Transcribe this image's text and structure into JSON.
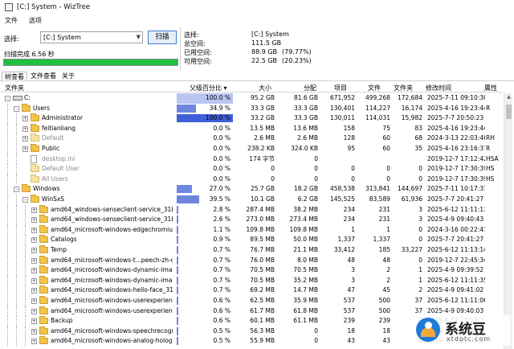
{
  "window": {
    "title": "[C:] System - WizTree"
  },
  "menu": [
    "文件",
    "选项"
  ],
  "scan": {
    "select_label": "选择:",
    "drive": "[C:] System",
    "scan_button": "扫描",
    "status": "扫描完成 6.56 秒",
    "progress_percent": 100
  },
  "info": {
    "selected_label": "选择:",
    "selected_value": "[C:] System",
    "total_label": "总空间:",
    "total_value": "111.5 GB",
    "used_label": "已用空间:",
    "used_value": "88.9 GB",
    "used_pct": "(79.77%)",
    "free_label": "可用空间:",
    "free_value": "22.5 GB",
    "free_pct": "(20.23%)"
  },
  "tabs": [
    "树查看",
    "文件查看",
    "关于"
  ],
  "columns": {
    "folder": "文件夹",
    "parent_pct": "父级百分比",
    "size": "大小",
    "allocated": "分配",
    "items": "项目",
    "files": "文件",
    "folders": "文件夹",
    "modified": "修改时间",
    "attributes": "属性"
  },
  "rows": [
    {
      "name": "C:",
      "pct": "100.0 %",
      "bar": 1.0,
      "size": "95.2 GB",
      "alloc": "81.6 GB",
      "items": "671,952",
      "files": "499,268",
      "folders": "172,684",
      "mod": "2025-7-11 09:10:30",
      "attr": ""
    },
    {
      "name": "Users",
      "pct": "34.9 %",
      "bar": 0.349,
      "size": "33.3 GB",
      "alloc": "33.3 GB",
      "items": "130,401",
      "files": "114,227",
      "folders": "16,174",
      "mod": "2025-4-16 19:23:44",
      "attr": "R"
    },
    {
      "name": "Administrator",
      "pct": "100.0 %",
      "bar": 1.0,
      "size": "33.2 GB",
      "alloc": "33.3 GB",
      "items": "130,011",
      "files": "114,031",
      "folders": "15,982",
      "mod": "2025-7-7 20:50:23",
      "attr": ""
    },
    {
      "name": "feitianliang",
      "pct": "0.0 %",
      "bar": 0,
      "size": "13.5 MB",
      "alloc": "13.6 MB",
      "items": "158",
      "files": "75",
      "folders": "83",
      "mod": "2025-4-16 19:23:44",
      "attr": ""
    },
    {
      "name": "Default",
      "pct": "0.0 %",
      "bar": 0,
      "size": "2.6 MB",
      "alloc": "2.6 MB",
      "items": "128",
      "files": "60",
      "folders": "68",
      "mod": "2024-3-13 22:03:46",
      "attr": "RH"
    },
    {
      "name": "Public",
      "pct": "0.0 %",
      "bar": 0,
      "size": "238.2 KB",
      "alloc": "324.0 KB",
      "items": "95",
      "files": "60",
      "folders": "35",
      "mod": "2025-4-16 23:16:37",
      "attr": "R"
    },
    {
      "name": "desktop.ini",
      "pct": "0.0 %",
      "bar": 0,
      "size": "174 字节",
      "alloc": "0",
      "items": "",
      "files": "",
      "folders": "",
      "mod": "2019-12-7 17:12:42",
      "attr": "HSA"
    },
    {
      "name": "Default User",
      "pct": "0.0 %",
      "bar": 0,
      "size": "0",
      "alloc": "0",
      "items": "0",
      "files": "0",
      "folders": "0",
      "mod": "2019-12-7 17:30:39",
      "attr": "HS"
    },
    {
      "name": "All Users",
      "pct": "0.0 %",
      "bar": 0,
      "size": "0",
      "alloc": "0",
      "items": "0",
      "files": "0",
      "folders": "0",
      "mod": "2019-12-7 17:30:39",
      "attr": "HS"
    },
    {
      "name": "Windows",
      "pct": "27.0 %",
      "bar": 0.27,
      "size": "25.7 GB",
      "alloc": "18.2 GB",
      "items": "458,538",
      "files": "313,841",
      "folders": "144,697",
      "mod": "2025-7-11 10:17:37",
      "attr": ""
    },
    {
      "name": "WinSxS",
      "pct": "39.5 %",
      "bar": 0.395,
      "size": "10.1 GB",
      "alloc": "6.2 GB",
      "items": "145,525",
      "files": "83,589",
      "folders": "61,936",
      "mod": "2025-7-7 20:41:27",
      "attr": ""
    },
    {
      "name": "amd64_windows-senseclient-service_31bf3856ad",
      "pct": "2.8 %",
      "bar": 0.028,
      "size": "287.4 MB",
      "alloc": "38.2 MB",
      "items": "234",
      "files": "231",
      "folders": "3",
      "mod": "2025-6-12 11:11:13",
      "attr": ""
    },
    {
      "name": "amd64_windows-senseclient-service_31bf3856ad",
      "pct": "2.6 %",
      "bar": 0.026,
      "size": "273.0 MB",
      "alloc": "273.4 MB",
      "items": "234",
      "files": "231",
      "folders": "3",
      "mod": "2025-4-9 09:40:43",
      "attr": ""
    },
    {
      "name": "amd64_microsoft-windows-edgechromium_31bf3",
      "pct": "1.1 %",
      "bar": 0.011,
      "size": "109.8 MB",
      "alloc": "109.8 MB",
      "items": "1",
      "files": "1",
      "folders": "0",
      "mod": "2024-3-16 00:22:41",
      "attr": ""
    },
    {
      "name": "Catalogs",
      "pct": "0.9 %",
      "bar": 0.009,
      "size": "89.5 MB",
      "alloc": "50.0 MB",
      "items": "1,337",
      "files": "1,337",
      "folders": "0",
      "mod": "2025-7-7 20:41:27",
      "attr": ""
    },
    {
      "name": "Temp",
      "pct": "0.7 %",
      "bar": 0.007,
      "size": "76.7 MB",
      "alloc": "21.1 MB",
      "items": "33,412",
      "files": "185",
      "folders": "33,227",
      "mod": "2025-6-12 11:13:14",
      "attr": ""
    },
    {
      "name": "amd64_microsoft-windows-t...peech-zh-cn-onecor",
      "pct": "0.7 %",
      "bar": 0.007,
      "size": "76.0 MB",
      "alloc": "8.0 MB",
      "items": "48",
      "files": "48",
      "folders": "0",
      "mod": "2019-12-7 22:45:34",
      "attr": ""
    },
    {
      "name": "amd64_microsoft-windows-dynamic-image_31bf3",
      "pct": "0.7 %",
      "bar": 0.007,
      "size": "70.5 MB",
      "alloc": "70.5 MB",
      "items": "3",
      "files": "2",
      "folders": "1",
      "mod": "2025-4-9 09:39:52",
      "attr": ""
    },
    {
      "name": "amd64_microsoft-windows-dynamic-image_31bf3",
      "pct": "0.7 %",
      "bar": 0.007,
      "size": "70.5 MB",
      "alloc": "35.2 MB",
      "items": "3",
      "files": "2",
      "folders": "1",
      "mod": "2025-6-12 11:11:35",
      "attr": ""
    },
    {
      "name": "amd64_microsoft-windows-hello-face_31bf3856a",
      "pct": "0.7 %",
      "bar": 0.007,
      "size": "69.2 MB",
      "alloc": "14.7 MB",
      "items": "47",
      "files": "45",
      "folders": "2",
      "mod": "2025-4-9 09:41:02",
      "attr": ""
    },
    {
      "name": "amd64_microsoft-windows-userexperience-deskto",
      "pct": "0.6 %",
      "bar": 0.006,
      "size": "62.5 MB",
      "alloc": "35.9 MB",
      "items": "537",
      "files": "500",
      "folders": "37",
      "mod": "2025-6-12 11:11:06",
      "attr": ""
    },
    {
      "name": "amd64_microsoft-windows-userexperience-deskto",
      "pct": "0.6 %",
      "bar": 0.006,
      "size": "61.7 MB",
      "alloc": "61.8 MB",
      "items": "537",
      "files": "500",
      "folders": "37",
      "mod": "2025-4-9 09:40:03",
      "attr": ""
    },
    {
      "name": "Backup",
      "pct": "0.6 %",
      "bar": 0.006,
      "size": "60.1 MB",
      "alloc": "61.1 MB",
      "items": "239",
      "files": "239",
      "folders": "0",
      "mod": "2025-6-12 11:12:23",
      "attr": ""
    },
    {
      "name": "amd64_microsoft-windows-speechrecognizer-zh-c",
      "pct": "0.5 %",
      "bar": 0.005,
      "size": "56.3 MB",
      "alloc": "0",
      "items": "18",
      "files": "18",
      "folders": "0",
      "mod": "2019-12-7 22:45:34",
      "attr": ""
    },
    {
      "name": "amd64_microsoft-windows-analog-holographic_31",
      "pct": "0.5 %",
      "bar": 0.005,
      "size": "55.9 MB",
      "alloc": "0",
      "items": "43",
      "files": "43",
      "folders": "0",
      "mod": "2019-12-7 22:45:34",
      "attr": ""
    }
  ],
  "watermark": {
    "text": "系统豆",
    "url": "xtdptc.com"
  }
}
